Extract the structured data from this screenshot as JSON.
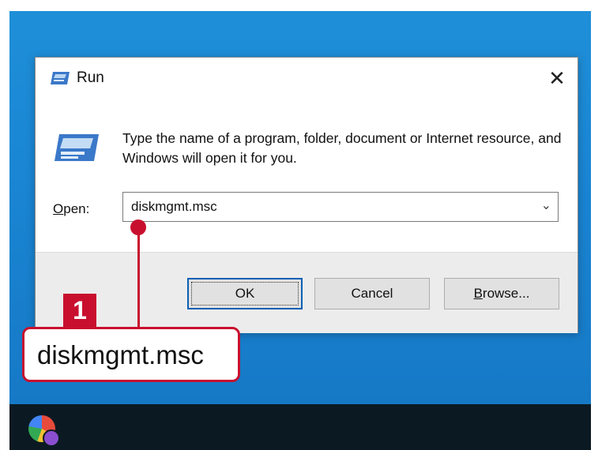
{
  "dialog": {
    "title": "Run",
    "close_glyph": "✕",
    "description": "Type the name of a program, folder, document or Internet resource, and Windows will open it for you.",
    "open_label": {
      "accel": "O",
      "rest": "pen:"
    },
    "open_value": "diskmgmt.msc",
    "dropdown_glyph": "⌄",
    "buttons": {
      "ok": "OK",
      "cancel": "Cancel",
      "browse": {
        "accel": "B",
        "rest": "rowse..."
      }
    }
  },
  "callout": {
    "number": "1",
    "text": "diskmgmt.msc",
    "color": "#c8102e"
  },
  "icons": {
    "title": "run-icon",
    "main": "run-icon",
    "taskbar": "app-icon"
  },
  "colors": {
    "desktop": "#1a86d4",
    "taskbar": "#0b1a22",
    "focus_border": "#0a5fb4"
  }
}
